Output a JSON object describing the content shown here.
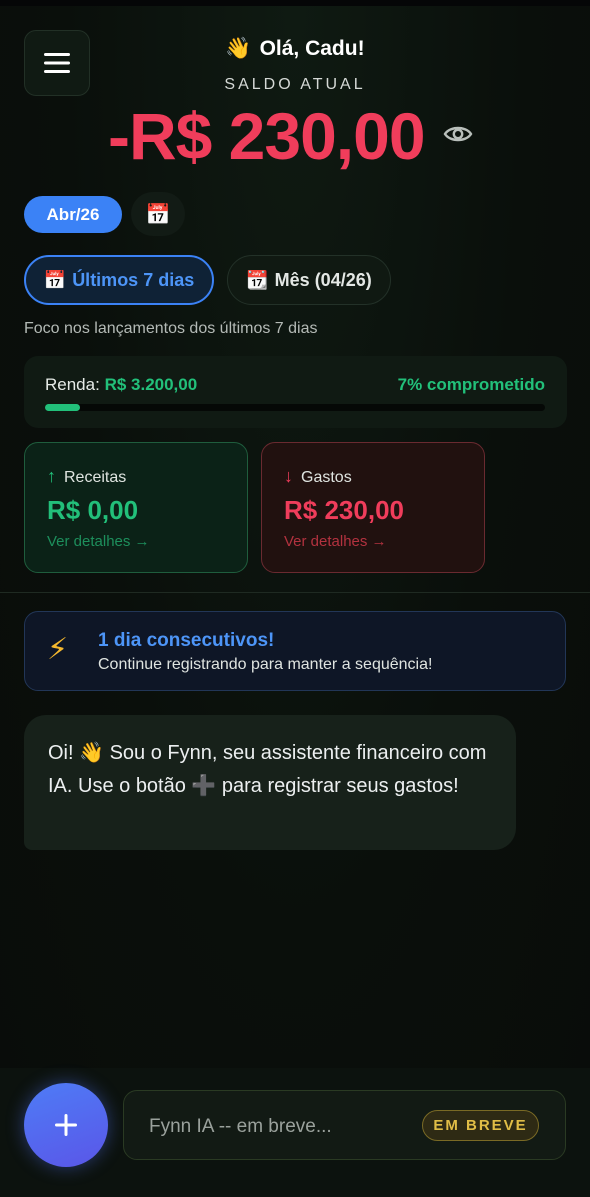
{
  "header": {
    "menu_icon": "hamburger-menu-icon",
    "greeting_emoji": "👋",
    "greeting": "Olá, Cadu!",
    "balance_label": "SALDO ATUAL",
    "balance_value": "-R$ 230,00",
    "visibility_icon": "eye-icon"
  },
  "period": {
    "month": "Abr/26",
    "calendar_icon": "📅",
    "filters": [
      {
        "icon": "📅",
        "label": "Últimos 7 dias",
        "active": true
      },
      {
        "icon": "📆",
        "label": "Mês (04/26)",
        "active": false
      }
    ],
    "focus_text": "Foco nos lançamentos dos últimos 7 dias"
  },
  "income": {
    "label": "Renda:",
    "value": "R$ 3.200,00",
    "committed_text": "7% comprometido",
    "committed_fraction": 0.07
  },
  "stats": {
    "receitas": {
      "arrow": "↑",
      "title": "Receitas",
      "value": "R$ 0,00",
      "link": "Ver detalhes →"
    },
    "gastos": {
      "arrow": "↓",
      "title": "Gastos",
      "value": "R$ 230,00",
      "link": "Ver detalhes →"
    }
  },
  "streak": {
    "icon": "⚡",
    "title": "1 dia consecutivos!",
    "subtitle": "Continue registrando para manter a sequência!"
  },
  "assistant": {
    "message": "Oi! 👋 Sou o Fynn, seu assistente financeiro com IA. Use o botão ➕ para registrar seus gastos!"
  },
  "composer": {
    "add_icon": "plus-icon",
    "placeholder": "Fynn IA -- em breve...",
    "badge": "EM BREVE"
  },
  "colors": {
    "negative": "#f03d5b",
    "positive": "#22c07a",
    "accent_blue": "#3b82f6",
    "warning": "#e0bd46"
  }
}
